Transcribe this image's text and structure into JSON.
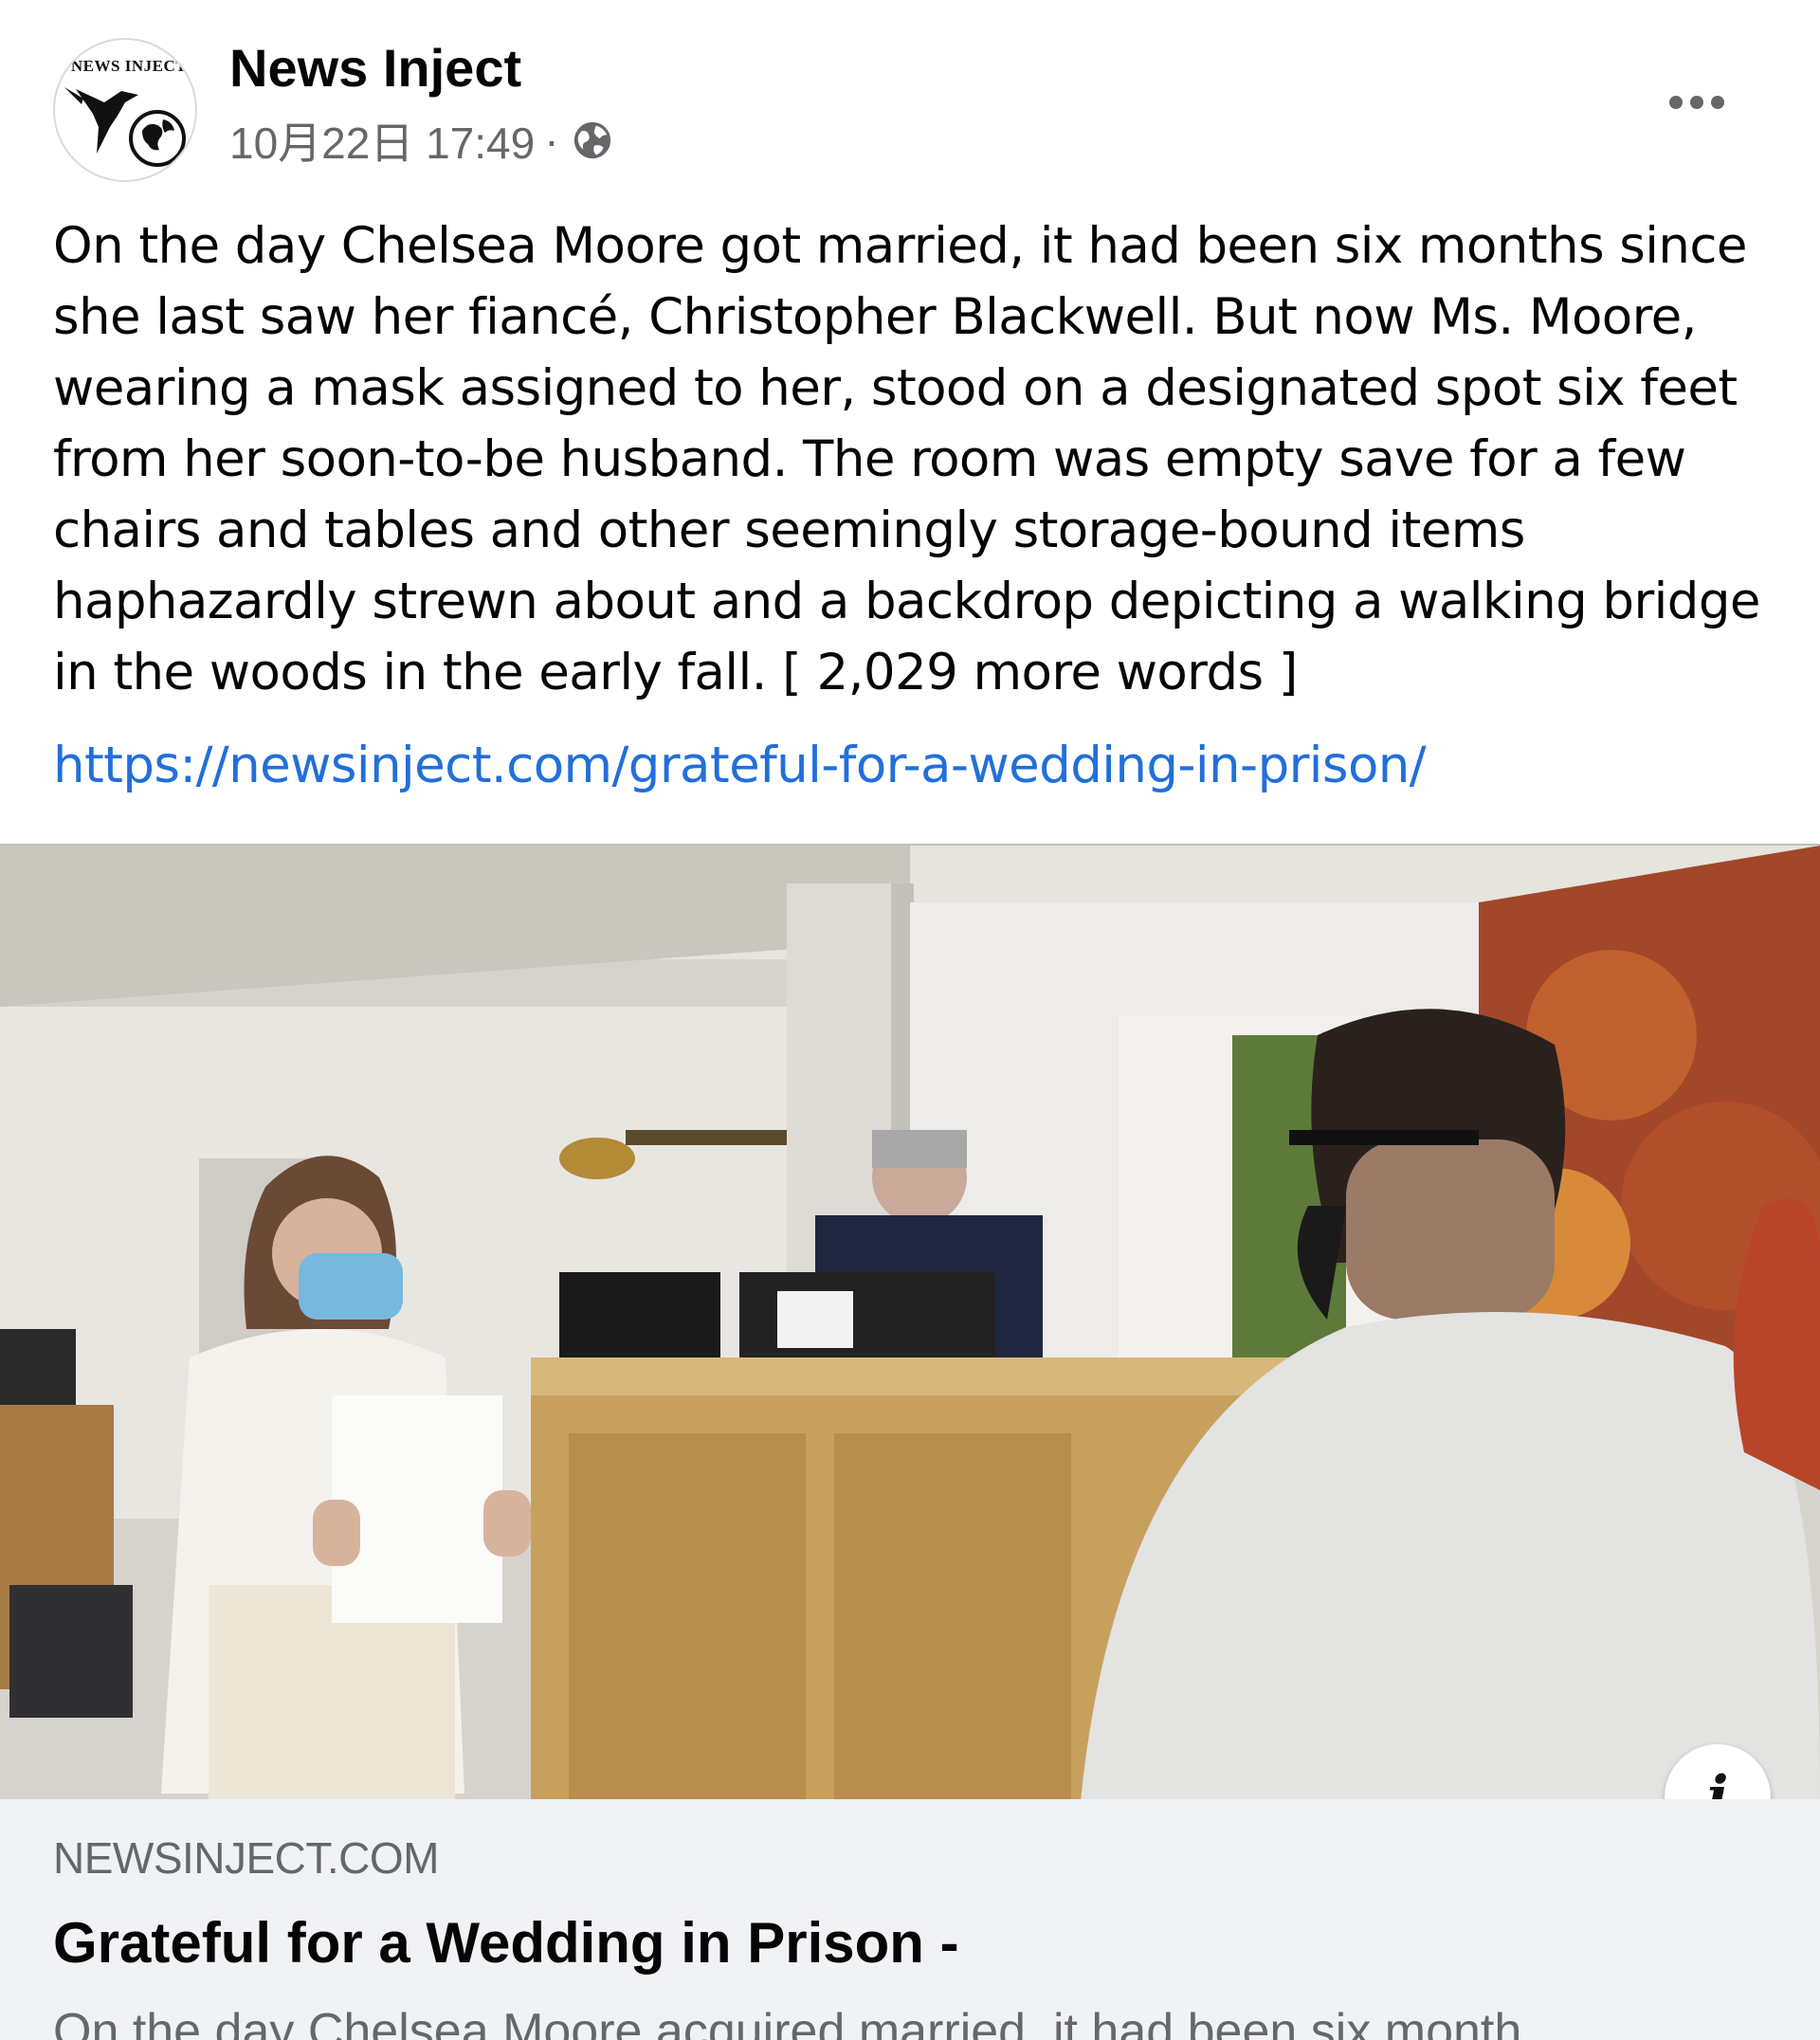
{
  "post": {
    "author": "News Inject",
    "avatar_text": "NEWS INJECT",
    "timestamp": "10月22日 17:49",
    "separator": "·",
    "privacy_icon": "globe-icon",
    "more_icon": "more-icon",
    "text": "On the day Chelsea Moore got married, it had been six months since\nshe last saw her fiancé, Christopher Blackwell. But now Ms. Moore,\nwearing a mask assigned to her, stood on a designated spot six feet\nfrom her soon-to-be husband. The room was empty save for a few\nchairs and tables and other seemingly storage-bound items\nhaphazardly strewn about and a backdrop depicting a walking bridge\nin the woods in the early fall. [ 2,029 more words ]",
    "link": "https://newsinject.com/grateful-for-a-wedding-in-prison/"
  },
  "preview": {
    "info_icon": "i",
    "domain": "NEWSINJECT.COM",
    "title": "Grateful for a Wedding in Prison -",
    "description": "On the day Chelsea Moore acquired married, it had been six month..."
  },
  "colors": {
    "link": "#216fdb",
    "secondary_text": "#65676b",
    "preview_footer_bg": "#f0f2f5"
  }
}
